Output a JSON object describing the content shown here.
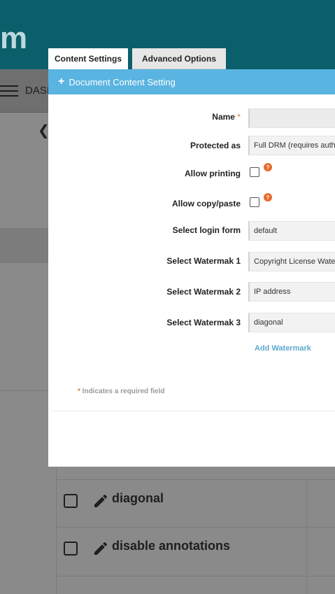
{
  "background": {
    "logo_text": "m",
    "nav_label": "DASI",
    "back_icon": "chevron-left-icon",
    "table_rows": [
      {
        "label": "diagonal"
      },
      {
        "label": "disable annotations"
      }
    ]
  },
  "tabs": [
    {
      "label": "Content Settings",
      "active": true
    },
    {
      "label": "Advanced Options",
      "active": false
    }
  ],
  "modal": {
    "header_title": "Document Content Setting",
    "header_icon": "plus-icon",
    "fields": {
      "name": {
        "label": "Name",
        "required_mark": "*",
        "value": ""
      },
      "protected_as": {
        "label": "Protected as",
        "value": "Full DRM (requires auth"
      },
      "allow_printing": {
        "label": "Allow printing",
        "checked": false,
        "help": "?"
      },
      "allow_copy": {
        "label": "Allow copy/paste",
        "checked": false,
        "help": "?"
      },
      "login_form": {
        "label": "Select login form",
        "value": "default"
      },
      "watermark1": {
        "label": "Select Watermak 1",
        "value": "Copyright License Wate"
      },
      "watermark2": {
        "label": "Select Watermak 2",
        "value": "IP address"
      },
      "watermark3": {
        "label": "Select Watermak 3",
        "value": "diagonal"
      }
    },
    "add_watermark_label": "Add Watermark",
    "required_note": {
      "mark": "*",
      "text": " Indicates a required field"
    }
  },
  "colors": {
    "header_teal": "#0b5f6b",
    "modal_header_blue": "#5ab4e1",
    "help_orange": "#e86a2a",
    "link_blue": "#5aa8cf"
  }
}
